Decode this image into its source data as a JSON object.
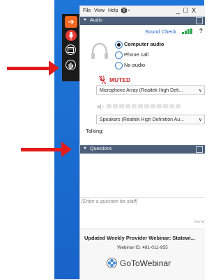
{
  "menu": {
    "file": "File",
    "view": "View",
    "help": "Help",
    "window_controls": "_ ☐ X"
  },
  "audio": {
    "header": "Audio",
    "sound_check": "Sound Check",
    "help_symbol": "?",
    "options": [
      "Computer audio",
      "Phone call",
      "No audio"
    ],
    "selected_option": "Computer audio",
    "status": "MUTED",
    "microphone": "Microphone Array (Realtek High Defi...",
    "speakers": "Speakers (Realtek High Definition Au...",
    "talking_label": "Talking:"
  },
  "questions": {
    "header": "Questions",
    "placeholder": "[Enter a question for staff]",
    "send": "Send"
  },
  "webinar": {
    "title": "Updated Weekly Provider Webinar: Statewi...",
    "id_text": "Webinar ID: 481-011-955",
    "brand": "GoToWebinar"
  },
  "colors": {
    "desktop": "#1e76d9",
    "section_header": "#4b5e7a",
    "muted_red": "#c62828",
    "link_blue": "#1a5fc6",
    "arrow_red": "#e31b1b",
    "toolbar_bg": "#1b1b1b",
    "toolbar_orange": "#f26722",
    "toolbar_red": "#e53935"
  },
  "icons": [
    "arrow-right-icon",
    "microphone-icon",
    "screen-icon",
    "raise-hand-icon",
    "headset-icon",
    "mic-muted-icon",
    "speaker-icon",
    "signal-bars-icon",
    "globe-icon",
    "popout-icon"
  ]
}
